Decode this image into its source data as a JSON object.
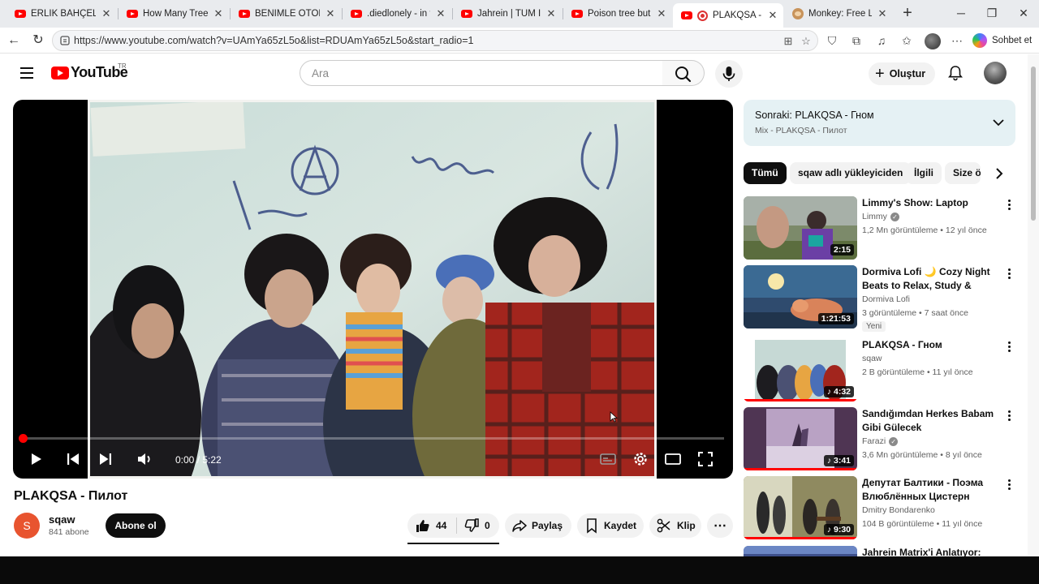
{
  "browser": {
    "tabs": [
      {
        "label": "ERLİK BAHÇELİ TAKI",
        "favicon": "youtube-icon",
        "active": false
      },
      {
        "label": "How Many Trees Are",
        "favicon": "youtube-icon",
        "active": false
      },
      {
        "label": "BENİMLE OTORİTE S",
        "favicon": "youtube-icon",
        "active": false
      },
      {
        "label": ".diedlonely - in the b",
        "favicon": "youtube-icon",
        "active": false
      },
      {
        "label": "Jahrein | TÜM İFTİRA",
        "favicon": "youtube-icon",
        "active": false
      },
      {
        "label": "Poison tree but it's d",
        "favicon": "youtube-icon",
        "active": false
      },
      {
        "label": "PLAKQSA - Пилот",
        "favicon": "recording-youtube-icon",
        "active": true
      },
      {
        "label": "Monkey: Free Li",
        "favicon": "monkey-icon",
        "active": false
      }
    ],
    "url": "https://www.youtube.com/watch?v=UAmYa65zL5o&list=RDUAmYa65zL5o&start_radio=1",
    "copilot_label": "Sohbet et"
  },
  "header": {
    "logo_text": "YouTube",
    "country_code": "TR",
    "search_placeholder": "Ara",
    "create_label": "Oluştur"
  },
  "player": {
    "time_current": "0:00",
    "time_total": "5:22",
    "time_display": "0:00 / 5:22",
    "progress": 0.0
  },
  "video": {
    "title": "PLAKQSA - Пилот",
    "channel": "sqaw",
    "channel_initial": "S",
    "subscribers": "841 abone",
    "subscribe_label": "Abone ol",
    "likes": "44",
    "dislikes": "0",
    "share_label": "Paylaş",
    "save_label": "Kaydet",
    "clip_label": "Klip"
  },
  "upnext": {
    "title": "Sonraki: PLAKQSA - Гном",
    "subtitle": "Mix - PLAKQSA - Пилот"
  },
  "chips": [
    "Tümü",
    "sqaw adlı yükleyiciden",
    "İlgili",
    "Size ö"
  ],
  "recommendations": [
    {
      "title": "Limmy's Show: Laptop",
      "channel": "Limmy",
      "verified": true,
      "meta": "1,2 Mn görüntüleme • 12 yıl önce",
      "duration": "2:15",
      "badge": ""
    },
    {
      "title": "Dormiva Lofi 🌙 Cozy Night Beats to Relax, Study & Sleep",
      "channel": "Dormiva Lofi",
      "verified": false,
      "meta": "3 görüntüleme • 7 saat önce",
      "duration": "1:21:53",
      "badge": "Yeni"
    },
    {
      "title": "PLAKQSA - Гном",
      "channel": "sqaw",
      "verified": false,
      "meta": "2 B görüntüleme • 11 yıl önce",
      "duration": "4:32",
      "badge": ""
    },
    {
      "title": "Sandığımdan Herkes Babam Gibi Gülecek",
      "channel": "Farazi",
      "verified": true,
      "meta": "3,6 Mn görüntüleme • 8 yıl önce",
      "duration": "3:41",
      "badge": ""
    },
    {
      "title": "Депутат Балтики - Поэма Влюблённых Цистерн",
      "channel": "Dmitry Bondarenko",
      "verified": false,
      "meta": "104 B görüntüleme • 11 yıl önce",
      "duration": "9:30",
      "badge": ""
    },
    {
      "title": "Jahrein Matrix'i Anlatıyor:",
      "channel": "",
      "verified": false,
      "meta": "",
      "duration": "",
      "badge": ""
    }
  ],
  "colors": {
    "youtube_red": "#ff0000",
    "upnext_bg": "#e5f1f4",
    "chip_active": "#0f0f0f"
  }
}
